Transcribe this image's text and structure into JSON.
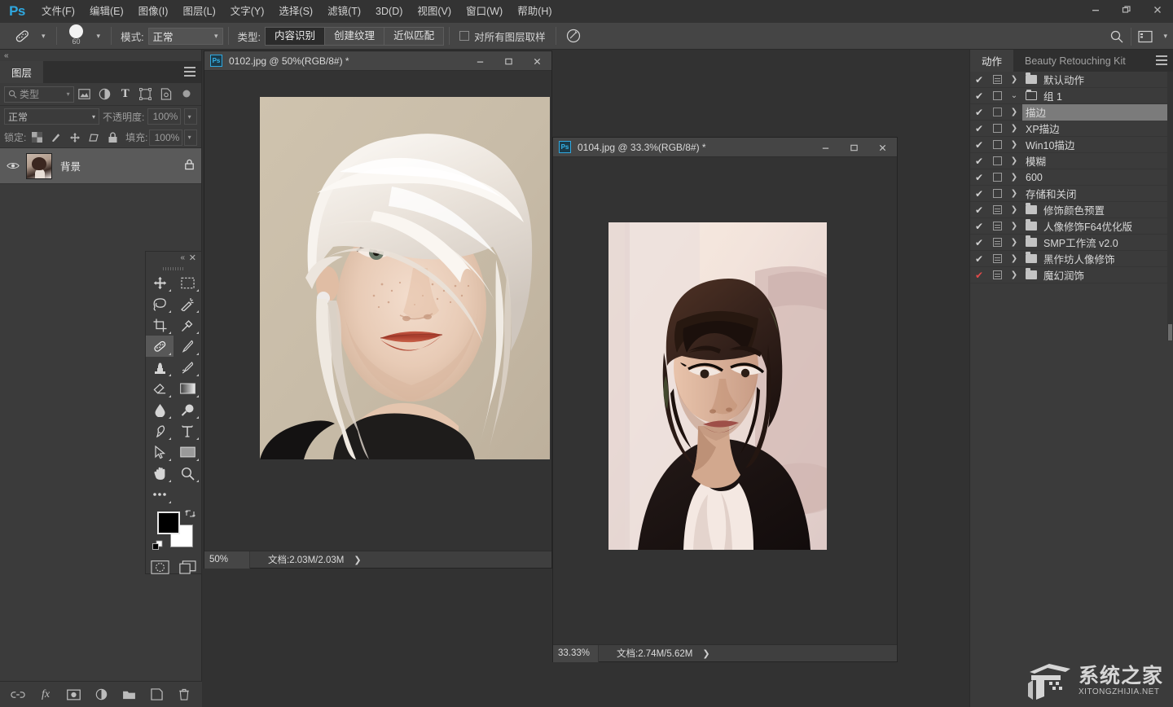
{
  "app": {
    "name": "Ps",
    "logo_color": "#2fa8e0"
  },
  "menubar": {
    "items": [
      {
        "label": "文件(F)",
        "name": "menu-file"
      },
      {
        "label": "编辑(E)",
        "name": "menu-edit"
      },
      {
        "label": "图像(I)",
        "name": "menu-image"
      },
      {
        "label": "图层(L)",
        "name": "menu-layer"
      },
      {
        "label": "文字(Y)",
        "name": "menu-type"
      },
      {
        "label": "选择(S)",
        "name": "menu-select"
      },
      {
        "label": "滤镜(T)",
        "name": "menu-filter"
      },
      {
        "label": "3D(D)",
        "name": "menu-3d"
      },
      {
        "label": "视图(V)",
        "name": "menu-view"
      },
      {
        "label": "窗口(W)",
        "name": "menu-window"
      },
      {
        "label": "帮助(H)",
        "name": "menu-help"
      }
    ],
    "window_controls": {
      "minimize": "—",
      "restore": "❐",
      "close": "✕"
    }
  },
  "options_bar": {
    "tool_icon": "healing-brush-icon",
    "brush_size": "60",
    "mode_label": "模式:",
    "mode_value": "正常",
    "type_label": "类型:",
    "type_buttons": [
      {
        "label": "内容识别",
        "active": true
      },
      {
        "label": "创建纹理",
        "active": false
      },
      {
        "label": "近似匹配",
        "active": false
      }
    ],
    "sample_all_layers": {
      "label": "对所有图层取样",
      "checked": false
    },
    "pressure_icon": "tablet-pressure-icon",
    "search_icon": "search-icon",
    "workspace_icon": "workspace-switcher-icon"
  },
  "layers_panel": {
    "tab_label": "图层",
    "filter": {
      "placeholder": "类型",
      "icons": [
        "image-filter-icon",
        "adjustment-filter-icon",
        "type-filter-icon",
        "shape-filter-icon",
        "smartobject-filter-icon",
        "filter-toggle-icon"
      ]
    },
    "blend_mode": "正常",
    "opacity_label": "不透明度:",
    "opacity_value": "100%",
    "lock_label": "锁定:",
    "lock_icons": [
      "lock-transparent-icon",
      "lock-image-icon",
      "lock-position-icon",
      "lock-artboard-icon",
      "lock-all-icon"
    ],
    "fill_label": "填充:",
    "fill_value": "100%",
    "layers": [
      {
        "name": "背景",
        "visible": true,
        "locked": true,
        "selected": true
      }
    ],
    "bottom_icons": [
      "link-layers-icon",
      "layer-style-icon",
      "layer-mask-icon",
      "adjustment-layer-icon",
      "new-group-icon",
      "new-layer-icon",
      "delete-layer-icon"
    ]
  },
  "toolbar": {
    "tools": [
      {
        "name": "move-tool",
        "glyph": "✥",
        "active": false
      },
      {
        "name": "rectangular-marquee-tool",
        "glyph": "▭",
        "active": false
      },
      {
        "name": "lasso-tool",
        "glyph": "lasso",
        "active": false
      },
      {
        "name": "magic-wand-tool",
        "glyph": "wand",
        "active": false
      },
      {
        "name": "crop-tool",
        "glyph": "crop",
        "active": false
      },
      {
        "name": "eyedropper-tool",
        "glyph": "dropper",
        "active": false
      },
      {
        "name": "spot-healing-brush-tool",
        "glyph": "heal",
        "active": true
      },
      {
        "name": "brush-tool",
        "glyph": "brush",
        "active": false
      },
      {
        "name": "clone-stamp-tool",
        "glyph": "stamp",
        "active": false
      },
      {
        "name": "history-brush-tool",
        "glyph": "hbrush",
        "active": false
      },
      {
        "name": "eraser-tool",
        "glyph": "eraser",
        "active": false
      },
      {
        "name": "gradient-tool",
        "glyph": "gradient",
        "active": false
      },
      {
        "name": "blur-tool",
        "glyph": "drop",
        "active": false
      },
      {
        "name": "dodge-tool",
        "glyph": "dodge",
        "active": false
      },
      {
        "name": "pen-tool",
        "glyph": "pen",
        "active": false
      },
      {
        "name": "horizontal-type-tool",
        "glyph": "T",
        "active": false
      },
      {
        "name": "path-selection-tool",
        "glyph": "arrow",
        "active": false
      },
      {
        "name": "rectangle-tool",
        "glyph": "rect",
        "active": false
      },
      {
        "name": "hand-tool",
        "glyph": "hand",
        "active": false
      },
      {
        "name": "zoom-tool",
        "glyph": "zoom",
        "active": false
      },
      {
        "name": "edit-toolbar-tool",
        "glyph": "dots",
        "active": false
      }
    ],
    "foreground_color": "#000000",
    "background_color": "#ffffff",
    "quick_mask_icon": "quick-mask-icon",
    "screen_mode_icon": "screen-mode-icon"
  },
  "documents": [
    {
      "name": "document-window-0102",
      "title": "0102.jpg @ 50%(RGB/8#) *",
      "zoom": "50%",
      "status": "文档:2.03M/2.03M",
      "controls": {
        "minimize": "—",
        "restore": "❐",
        "close": "✕"
      }
    },
    {
      "name": "document-window-0104",
      "title": "0104.jpg @ 33.3%(RGB/8#) *",
      "zoom": "33.33%",
      "status": "文档:2.74M/5.62M",
      "controls": {
        "minimize": "—",
        "restore": "❐",
        "close": "✕"
      }
    }
  ],
  "actions_panel": {
    "tabs": [
      {
        "label": "动作",
        "active": true
      },
      {
        "label": "Beauty Retouching Kit",
        "active": false
      }
    ],
    "rows": [
      {
        "label": "默认动作",
        "type": "set",
        "checked": true,
        "check_color": "white",
        "expanded": false,
        "indent": 0,
        "highlight": false
      },
      {
        "label": "组 1",
        "type": "set",
        "checked": true,
        "check_color": "white",
        "expanded": true,
        "indent": 0,
        "highlight": false
      },
      {
        "label": "描边",
        "type": "action",
        "checked": true,
        "check_color": "white",
        "expanded": false,
        "indent": 1,
        "highlight": true
      },
      {
        "label": "XP描边",
        "type": "action",
        "checked": true,
        "check_color": "white",
        "expanded": false,
        "indent": 1,
        "highlight": false
      },
      {
        "label": "Win10描边",
        "type": "action",
        "checked": true,
        "check_color": "white",
        "expanded": false,
        "indent": 1,
        "highlight": false
      },
      {
        "label": "模糊",
        "type": "action",
        "checked": true,
        "check_color": "white",
        "expanded": false,
        "indent": 1,
        "highlight": false
      },
      {
        "label": "600",
        "type": "action",
        "checked": true,
        "check_color": "white",
        "expanded": false,
        "indent": 1,
        "highlight": false
      },
      {
        "label": "存储和关闭",
        "type": "action",
        "checked": true,
        "check_color": "white",
        "expanded": false,
        "indent": 1,
        "highlight": false
      },
      {
        "label": "修饰颜色预置",
        "type": "set",
        "checked": true,
        "check_color": "white",
        "expanded": false,
        "indent": 0,
        "highlight": false
      },
      {
        "label": "人像修饰F64优化版",
        "type": "set",
        "checked": true,
        "check_color": "white",
        "expanded": false,
        "indent": 0,
        "highlight": false
      },
      {
        "label": "SMP工作流  v2.0",
        "type": "set",
        "checked": true,
        "check_color": "white",
        "expanded": false,
        "indent": 0,
        "highlight": false
      },
      {
        "label": "黑作坊人像修饰",
        "type": "set",
        "checked": true,
        "check_color": "white",
        "expanded": false,
        "indent": 0,
        "highlight": false
      },
      {
        "label": "魔幻润饰",
        "type": "set",
        "checked": true,
        "check_color": "red",
        "expanded": false,
        "indent": 0,
        "highlight": false
      }
    ],
    "menu_icon": "panel-menu-icon"
  },
  "watermark": {
    "cn": "系统之家",
    "en": "XITONGZHIJIA.NET"
  }
}
